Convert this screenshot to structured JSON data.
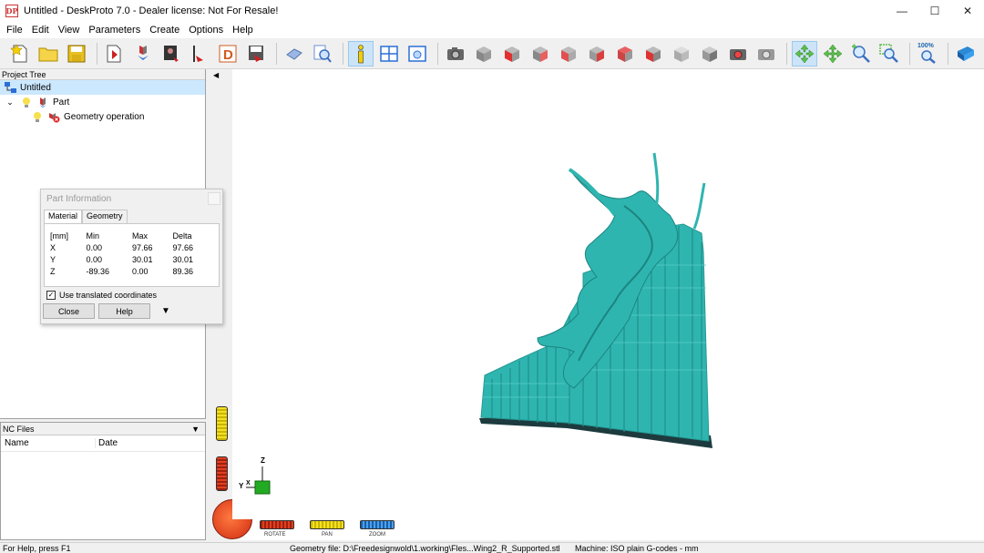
{
  "window": {
    "title": "Untitled - DeskProto 7.0 - Dealer license: Not For Resale!",
    "logo_text": "DP",
    "minimize": "—",
    "maximize": "☐",
    "close": "✕"
  },
  "menu": [
    "File",
    "Edit",
    "View",
    "Parameters",
    "Create",
    "Options",
    "Help"
  ],
  "toolbar": {
    "zoom_level": "100%"
  },
  "project_tree": {
    "header": "Project Tree",
    "root": "Untitled",
    "part": "Part",
    "operation": "Geometry operation"
  },
  "nc_files": {
    "header": "NC Files",
    "col_name": "Name",
    "col_date": "Date"
  },
  "dialog": {
    "title": "Part Information",
    "tabs": [
      "Material",
      "Geometry"
    ],
    "headers": [
      "[mm]",
      "Min",
      "Max",
      "Delta"
    ],
    "rows": [
      [
        "X",
        "0.00",
        "97.66",
        "97.66"
      ],
      [
        "Y",
        "0.00",
        "30.01",
        "30.01"
      ],
      [
        "Z",
        "-89.36",
        "0.00",
        "89.36"
      ]
    ],
    "checkbox_label": "Use translated coordinates",
    "checkbox_checked": true,
    "close_label": "Close",
    "help_label": "Help"
  },
  "viewport": {
    "axis_z": "Z",
    "axis_y": "Y",
    "axis_x": "X",
    "model_color": "#2fb5b0",
    "base_color": "#1d3b3e"
  },
  "mouse_controls": {
    "rotate": "ROTATE",
    "pan": "PAN",
    "zoom": "ZOOM"
  },
  "status": {
    "help": "For Help, press F1",
    "geometry_file": "Geometry file: D:\\Freedesignwold\\1.working\\Fles...Wing2_R_Supported.stl",
    "machine": "Machine: ISO plain G-codes - mm"
  }
}
